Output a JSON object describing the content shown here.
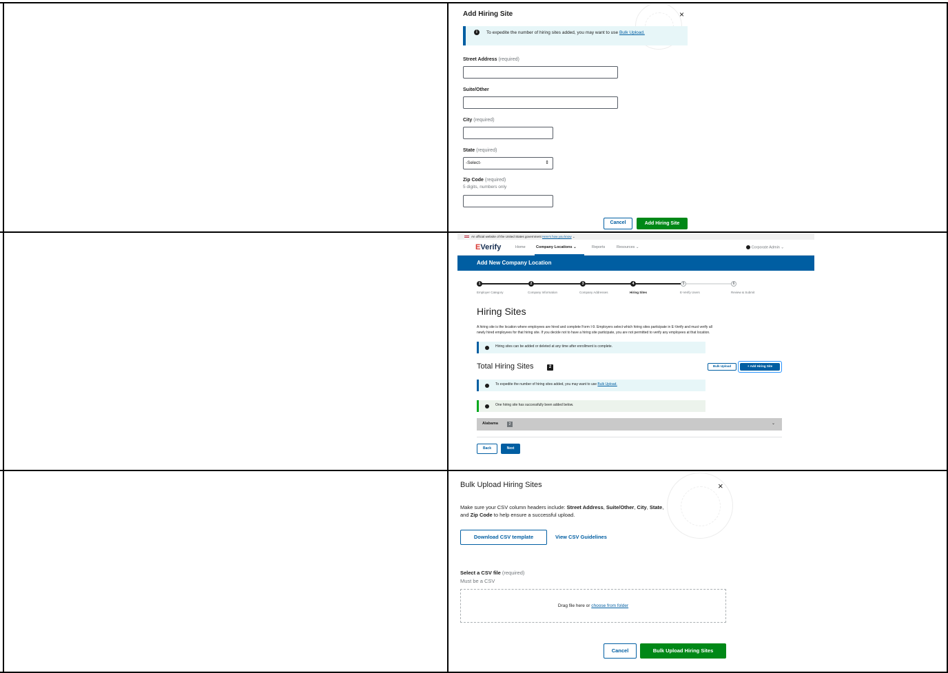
{
  "add_site_modal": {
    "title": "Add Hiring Site",
    "close": "×",
    "info_text": "To expedite the number of hiring sites added, you may want to use ",
    "info_link": "Bulk Upload.",
    "street_label": "Street Address",
    "suite_label": "Suite/Other",
    "city_label": "City",
    "state_label": "State",
    "required": "(required)",
    "state_select": "-Select-",
    "zip_label": "Zip Code",
    "zip_hint": "5 digits, numbers only",
    "cancel": "Cancel",
    "submit": "Add Hiring Site"
  },
  "everify_page": {
    "gov_banner": "An official website of the United States government",
    "gov_banner_link": "Here's how you know",
    "logo_e": "E",
    "logo_rest": "Verify",
    "nav": {
      "home": "Home",
      "company_locations": "Company Locations",
      "reports": "Reports",
      "resources": "Resources",
      "user": "Corporate Admin"
    },
    "page_title": "Add New Company Location",
    "steps": [
      {
        "num": "1",
        "label": "Employer Category"
      },
      {
        "num": "2",
        "label": "Company Information"
      },
      {
        "num": "3",
        "label": "Company Addresses"
      },
      {
        "num": "4",
        "label": "Hiring Sites"
      },
      {
        "num": "5",
        "label": "E-Verify Users"
      },
      {
        "num": "6",
        "label": "Review & Submit"
      }
    ],
    "current_step": 4,
    "heading": "Hiring Sites",
    "description_1": "A hiring site is the location where employees are hired and complete Form I-9. Employers select which hiring sites participate in E-Verify and must verify all",
    "description_2": "newly hired employees for that hiring site. If you decide not to have a hiring site participate, you are not permitted to verify any employees at that location.",
    "alert_info": "Hiring sites can be added or deleted at any time after enrollment is complete.",
    "total_label": "Total Hiring Sites",
    "total_count": "2",
    "bulk_upload_btn": "Bulk Upload",
    "add_site_btn": "+ Add Hiring Site",
    "alert_expedite": "To expedite the number of hiring sites added, you may want to use ",
    "alert_expedite_link": "Bulk Upload.",
    "alert_success": "One hiring site has successfully been added below.",
    "accordion_title": "Alabama",
    "accordion_count": "2",
    "back": "Back",
    "next": "Next"
  },
  "bulk_modal": {
    "title": "Bulk Upload Hiring Sites",
    "close": "×",
    "instr_1a": "Make sure your CSV column headers include: ",
    "h_street": "Street Address",
    "sep": ", ",
    "h_suite": "Suite/Other",
    "h_city": "City",
    "h_state": "State",
    "instr_2a": "and ",
    "h_zip": "Zip Code",
    "instr_2b": " to help ensure a successful upload.",
    "download_btn": "Download CSV template",
    "guidelines_link": "View CSV Guidelines",
    "file_label": "Select a CSV file",
    "required": "(required)",
    "file_hint": "Must be a CSV",
    "dz_text": "Drag file here or ",
    "dz_link": "choose from folder",
    "cancel": "Cancel",
    "submit": "Bulk Upload Hiring Sites"
  },
  "colors": {
    "primary_blue": "#005ea2",
    "success_green": "#008817",
    "info_bg": "#e7f6f8"
  }
}
